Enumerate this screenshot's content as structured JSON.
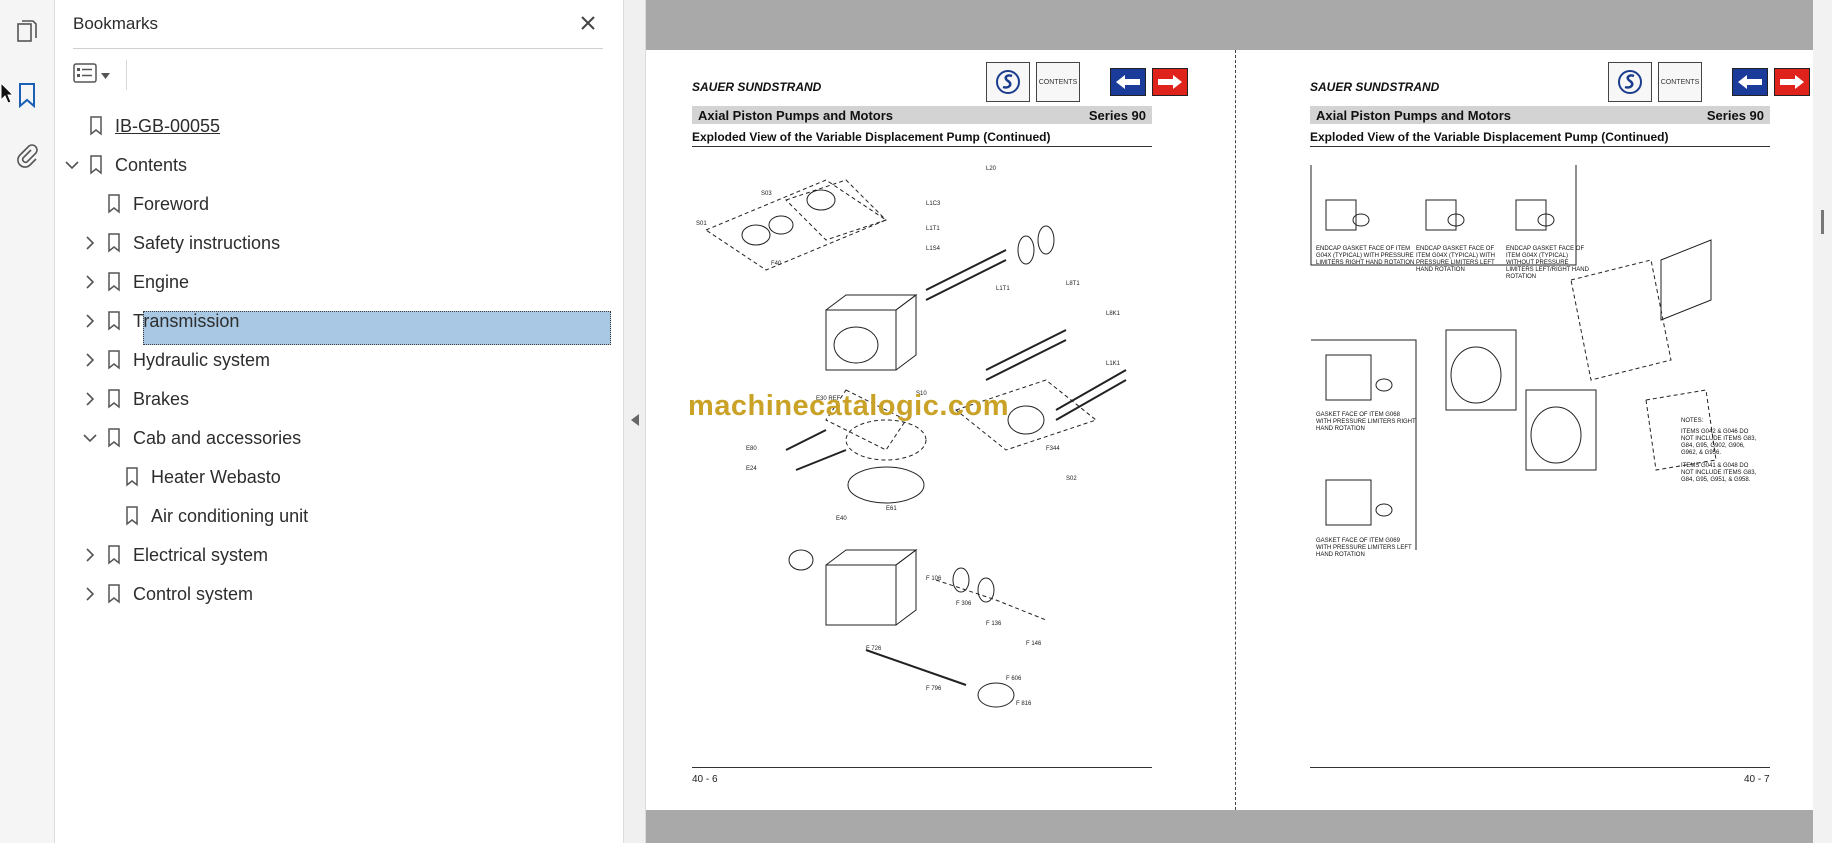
{
  "panel": {
    "title": "Bookmarks"
  },
  "bookmarks": [
    {
      "label": "IB-GB-00055",
      "level": 0,
      "expandable": false,
      "expanded": false,
      "link": true
    },
    {
      "label": "Contents",
      "level": 0,
      "expandable": true,
      "expanded": true
    },
    {
      "label": "Foreword",
      "level": 1,
      "expandable": false
    },
    {
      "label": "Safety instructions",
      "level": 1,
      "expandable": true,
      "expanded": false
    },
    {
      "label": "Engine",
      "level": 1,
      "expandable": true,
      "expanded": false
    },
    {
      "label": "Transmission",
      "level": 1,
      "expandable": true,
      "expanded": false,
      "selected": true
    },
    {
      "label": "Hydraulic system",
      "level": 1,
      "expandable": true,
      "expanded": false
    },
    {
      "label": "Brakes",
      "level": 1,
      "expandable": true,
      "expanded": false
    },
    {
      "label": "Cab and accessories",
      "level": 1,
      "expandable": true,
      "expanded": true
    },
    {
      "label": "Heater Webasto",
      "level": 2,
      "expandable": false
    },
    {
      "label": "Air conditioning unit",
      "level": 2,
      "expandable": false
    },
    {
      "label": "Electrical system",
      "level": 1,
      "expandable": true,
      "expanded": false
    },
    {
      "label": "Control system",
      "level": 1,
      "expandable": true,
      "expanded": false
    }
  ],
  "document": {
    "brand": "SAUER SUNDSTRAND",
    "contents_label": "CONTENTS",
    "header_left": "Axial Piston Pumps and Motors",
    "header_right": "Series 90",
    "subtitle": "Exploded View of the Variable Displacement Pump (Continued)",
    "left_page_number": "40 - 6",
    "right_page_number": "40 - 7",
    "watermark": "machinecatalogic.com",
    "right_notes": {
      "notes_title": "NOTES:",
      "note_1": "ITEMS G042 & G046 DO NOT INCLUDE ITEMS G83, G84, G95, G902, G906, G962, & G956.",
      "note_2": "ITEMS G041 & G048 DO NOT INCLUDE ITEMS G83, G84, G95, G951, & G958.",
      "caption_1": "ENDCAP GASKET FACE OF ITEM G04X (TYPICAL) WITH PRESSURE LIMITERS RIGHT HAND ROTATION",
      "caption_2": "ENDCAP GASKET FACE OF ITEM G04X (TYPICAL) WITH PRESSURE LIMITERS LEFT HAND ROTATION",
      "caption_3": "ENDCAP GASKET FACE OF ITEM G04X (TYPICAL) WITHOUT PRESSURE LIMITERS LEFT/RIGHT HAND ROTATION",
      "caption_4": "GASKET FACE OF ITEM G068 WITH PRESSURE LIMITERS RIGHT HAND ROTATION",
      "caption_5": "GASKET FACE OF ITEM G069 WITH PRESSURE LIMITERS LEFT HAND ROTATION"
    }
  },
  "colors": {
    "selection": "#a8c8e4",
    "accent_blue": "#1a5fb4",
    "arrow_blue": "#1b3b9b",
    "arrow_red": "#e0221c",
    "watermark": "#c9a227",
    "viewer_bg": "#a9a9a9"
  },
  "icons": {
    "rail": [
      "pages-icon",
      "bookmark-icon",
      "attachment-icon"
    ],
    "panel": [
      "close-icon",
      "options-icon",
      "chevron-down-icon"
    ]
  }
}
